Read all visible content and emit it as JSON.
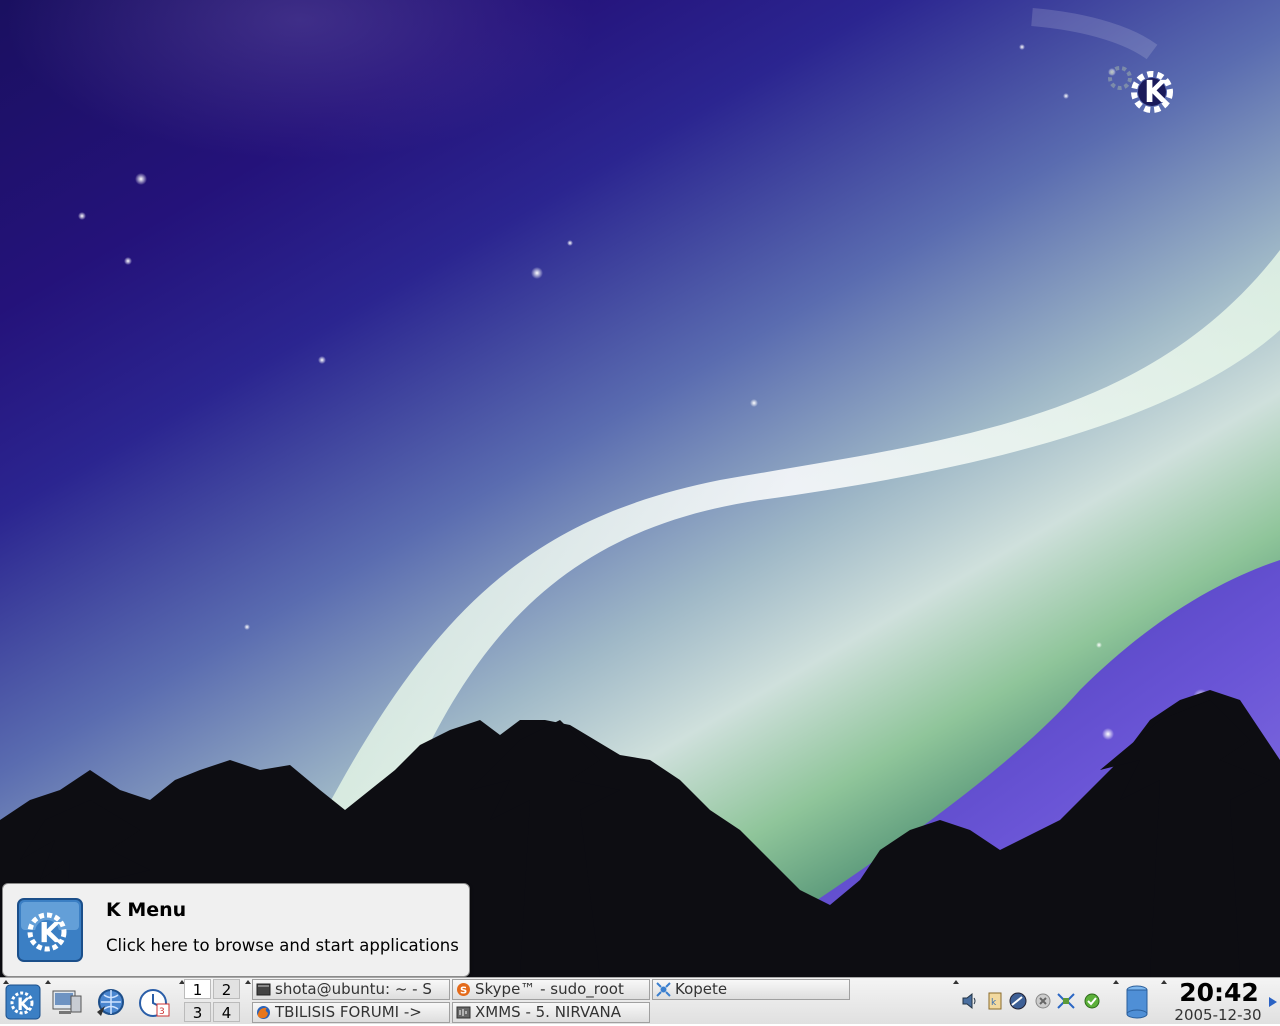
{
  "tooltip": {
    "title": "K Menu",
    "text": "Click here to browse and start applications"
  },
  "panel": {
    "launchers": [
      {
        "name": "kmenu",
        "icon": "kde-k-icon"
      },
      {
        "name": "show-desktop",
        "icon": "desktop-icon"
      },
      {
        "name": "web-browser",
        "icon": "konqueror-globe-icon"
      },
      {
        "name": "calendar",
        "icon": "calendar-clock-icon"
      }
    ],
    "pager": [
      "1",
      "2",
      "3",
      "4"
    ],
    "tasks": [
      {
        "label": "shota@ubuntu: ~ - S",
        "icon": "terminal-icon"
      },
      {
        "label": "Skype™ - sudo_root",
        "icon": "skype-icon"
      },
      {
        "label": "Kopete",
        "icon": "kopete-icon"
      },
      {
        "label": "TBILISIS FORUMI ->",
        "icon": "firefox-icon"
      },
      {
        "label": "XMMS - 5. NIRVANA",
        "icon": "xmms-icon"
      }
    ],
    "tray": [
      "volume-icon",
      "klipper-icon",
      "network-icon",
      "close-circle-icon",
      "network-manager-icon",
      "update-icon"
    ],
    "clock": {
      "time": "20:42",
      "date": "2005-12-30"
    }
  },
  "colors": {
    "sky_top": "#1a1060",
    "aurora_green": "#8fc59a",
    "panel_bg": "#e8e8e8",
    "kde_blue": "#3b7fc4"
  }
}
